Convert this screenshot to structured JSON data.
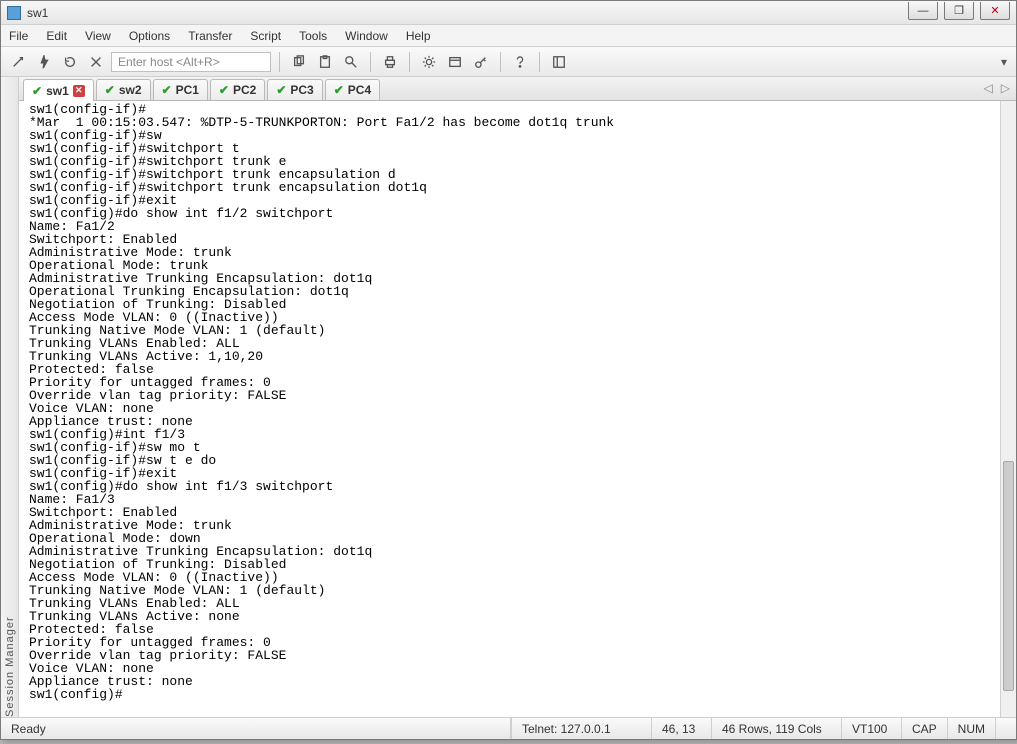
{
  "window": {
    "title": "sw1",
    "controls": {
      "min": "—",
      "max": "❐",
      "close": "✕"
    }
  },
  "menubar": [
    "File",
    "Edit",
    "View",
    "Options",
    "Transfer",
    "Script",
    "Tools",
    "Window",
    "Help"
  ],
  "toolbar": {
    "host_placeholder": "Enter host <Alt+R>"
  },
  "sidebar": {
    "label": "Session Manager"
  },
  "tabs": [
    {
      "id": "sw1",
      "label": "sw1",
      "active": true,
      "closable": true
    },
    {
      "id": "sw2",
      "label": "sw2",
      "active": false,
      "closable": false
    },
    {
      "id": "pc1",
      "label": "PC1",
      "active": false,
      "closable": false
    },
    {
      "id": "pc2",
      "label": "PC2",
      "active": false,
      "closable": false
    },
    {
      "id": "pc3",
      "label": "PC3",
      "active": false,
      "closable": false
    },
    {
      "id": "pc4",
      "label": "PC4",
      "active": false,
      "closable": false
    }
  ],
  "tab_nav": {
    "prev": "◁",
    "next": "▷"
  },
  "terminal": {
    "lines": [
      "sw1(config-if)#",
      "*Mar  1 00:15:03.547: %DTP-5-TRUNKPORTON: Port Fa1/2 has become dot1q trunk",
      "sw1(config-if)#sw",
      "sw1(config-if)#switchport t",
      "sw1(config-if)#switchport trunk e",
      "sw1(config-if)#switchport trunk encapsulation d",
      "sw1(config-if)#switchport trunk encapsulation dot1q",
      "sw1(config-if)#exit",
      "sw1(config)#do show int f1/2 switchport",
      "Name: Fa1/2",
      "Switchport: Enabled",
      "Administrative Mode: trunk",
      "Operational Mode: trunk",
      "Administrative Trunking Encapsulation: dot1q",
      "Operational Trunking Encapsulation: dot1q",
      "Negotiation of Trunking: Disabled",
      "Access Mode VLAN: 0 ((Inactive))",
      "Trunking Native Mode VLAN: 1 (default)",
      "Trunking VLANs Enabled: ALL",
      "Trunking VLANs Active: 1,10,20",
      "Protected: false",
      "Priority for untagged frames: 0",
      "Override vlan tag priority: FALSE",
      "Voice VLAN: none",
      "Appliance trust: none",
      "sw1(config)#int f1/3",
      "sw1(config-if)#sw mo t",
      "sw1(config-if)#sw t e do",
      "sw1(config-if)#exit",
      "sw1(config)#do show int f1/3 switchport",
      "Name: Fa1/3",
      "Switchport: Enabled",
      "Administrative Mode: trunk",
      "Operational Mode: down",
      "Administrative Trunking Encapsulation: dot1q",
      "Negotiation of Trunking: Disabled",
      "Access Mode VLAN: 0 ((Inactive))",
      "Trunking Native Mode VLAN: 1 (default)",
      "Trunking VLANs Enabled: ALL",
      "Trunking VLANs Active: none",
      "Protected: false",
      "Priority for untagged frames: 0",
      "Override vlan tag priority: FALSE",
      "Voice VLAN: none",
      "Appliance trust: none",
      "sw1(config)#"
    ]
  },
  "statusbar": {
    "ready": "Ready",
    "conn": "Telnet: 127.0.0.1",
    "cursor": "46,  13",
    "size": "46 Rows, 119 Cols",
    "emul": "VT100",
    "cap": "CAP",
    "num": "NUM"
  }
}
